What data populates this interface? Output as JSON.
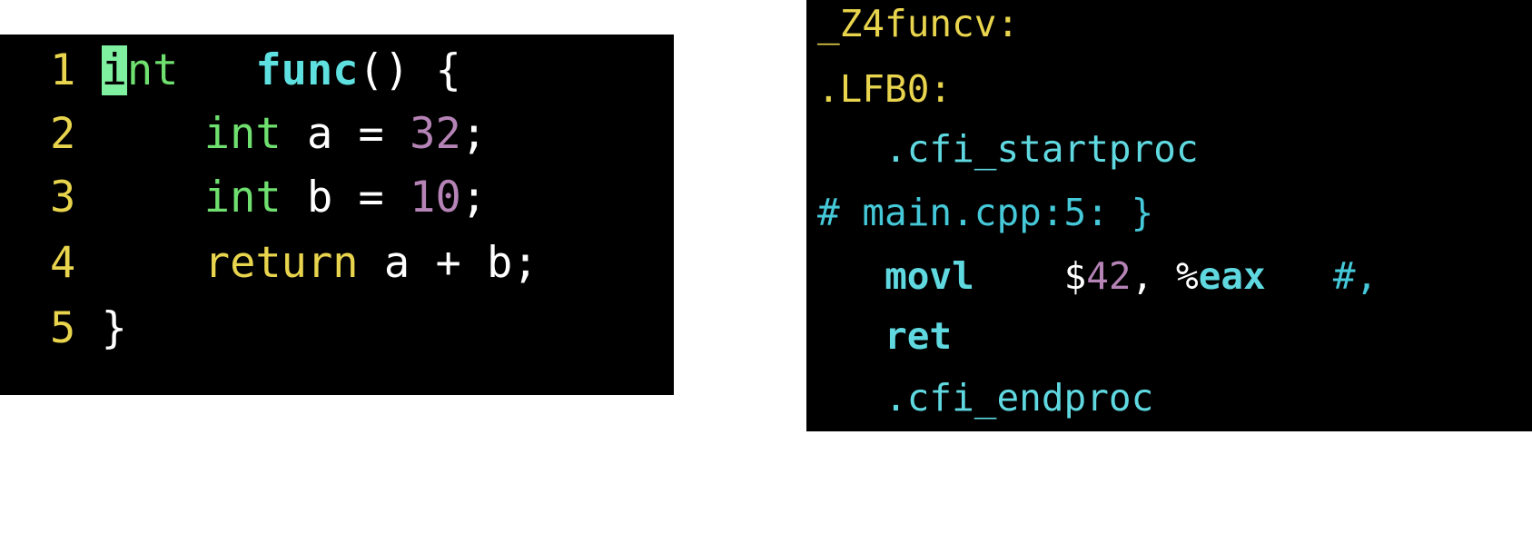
{
  "source": {
    "lines": [
      {
        "num": "1",
        "cursor_char": "i",
        "type_rest": "nt",
        "sp1": " ",
        "fn": "func",
        "rest": "() {"
      },
      {
        "num": "2",
        "indent": "    ",
        "type": "int",
        "mid": " a = ",
        "value": "32",
        "end": ";"
      },
      {
        "num": "3",
        "indent": "    ",
        "type": "int",
        "mid": " b = ",
        "value": "10",
        "end": ";"
      },
      {
        "num": "4",
        "indent": "    ",
        "kw": "return",
        "rest": " a + b;"
      },
      {
        "num": "5",
        "rest": "}"
      }
    ]
  },
  "asm": {
    "label1": "_Z4funcv:",
    "label2": ".LFB0:",
    "directive_start": ".cfi_startproc",
    "comment": "# main.cpp:5: }",
    "movl": {
      "instr": "movl",
      "imm_prefix": "$",
      "imm": "42",
      "sep": ", %",
      "reg": "eax",
      "trail": "#,"
    },
    "ret": "ret",
    "directive_end": ".cfi_endproc"
  },
  "colors": {
    "background": "#000000",
    "line_number": "#e8d44d",
    "type_keyword": "#6fe06f",
    "function_name": "#5fe0e0",
    "number": "#b583b5",
    "cursor": "#7ff0a0"
  }
}
